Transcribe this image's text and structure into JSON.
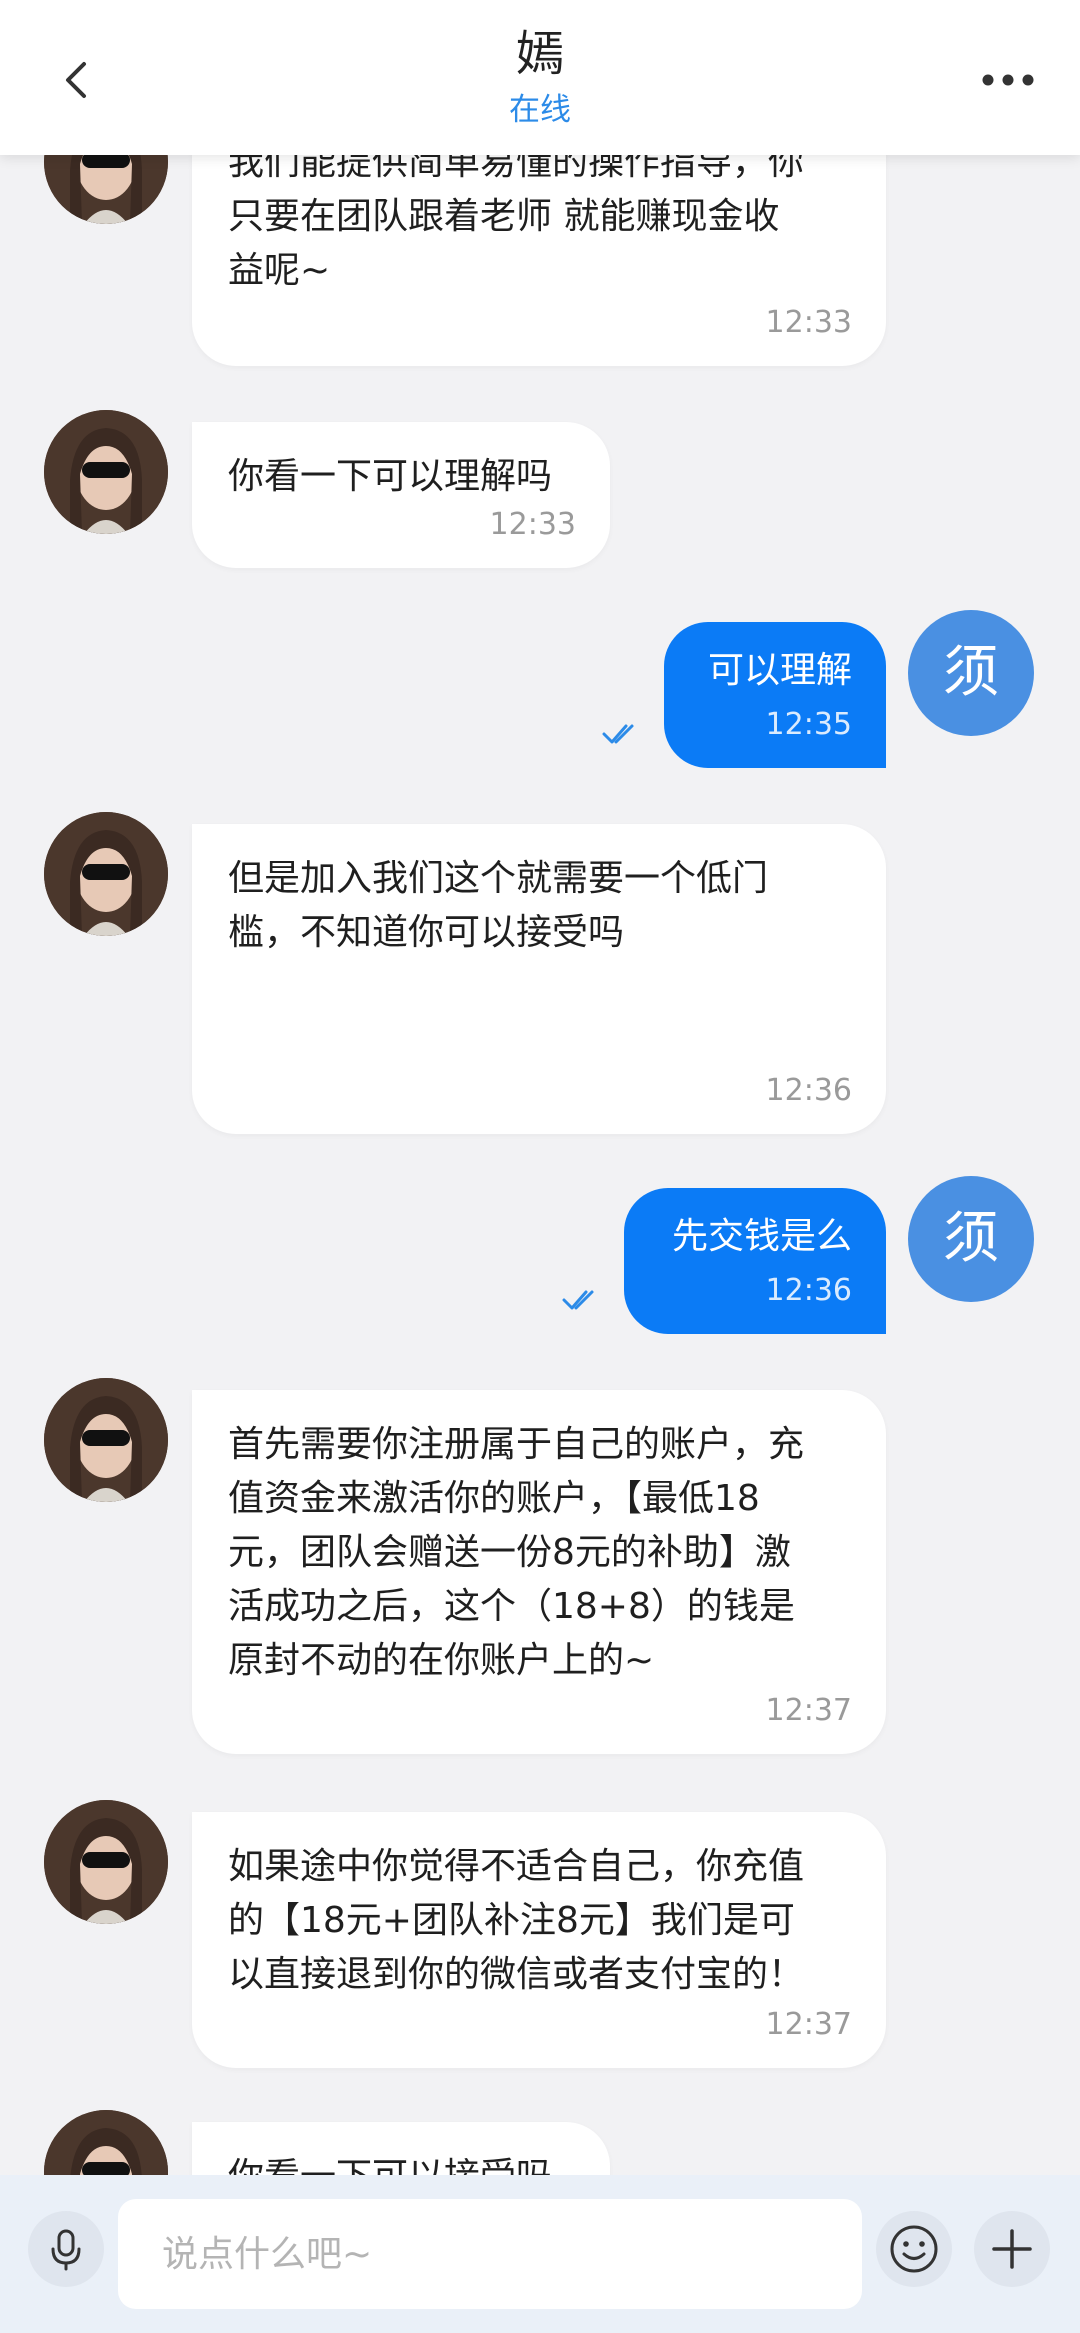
{
  "header": {
    "title": "嫣",
    "status": "在线",
    "back_icon": "chevron-left-icon",
    "more_icon": "more-horizontal-icon",
    "status_color": "#2c8be8"
  },
  "me": {
    "avatar_text": "须",
    "avatar_color": "#4a90e2",
    "bubble_color": "#0b7bf6"
  },
  "messages": [
    {
      "from": "her",
      "text": "我们能提供简单易懂的操作指导，你\n只要在团队跟着老师 就能赚现金收\n益呢~",
      "time": "12:33"
    },
    {
      "from": "her",
      "text": "你看一下可以理解吗",
      "time": "12:33"
    },
    {
      "from": "me",
      "text": "可以理解",
      "time": "12:35",
      "status": "read"
    },
    {
      "from": "her",
      "text": "但是加入我们这个就需要一个低门\n槛，不知道你可以接受吗",
      "time": "12:36"
    },
    {
      "from": "me",
      "text": "先交钱是么",
      "time": "12:36",
      "status": "read"
    },
    {
      "from": "her",
      "text": "首先需要你注册属于自己的账户，充\n值资金来激活你的账户，【最低18\n元，团队会赠送一份8元的补助】激\n活成功之后，这个（18+8）的钱是\n原封不动的在你账户上的~",
      "time": "12:37"
    },
    {
      "from": "her",
      "text": "如果途中你觉得不适合自己，你充值\n的【18元+团队补注8元】我们是可\n以直接退到你的微信或者支付宝的！",
      "time": "12:37"
    },
    {
      "from": "her",
      "text": "你看一下可以接受吗",
      "time": ""
    }
  ],
  "input": {
    "placeholder": "说点什么吧~",
    "value": "",
    "mic_icon": "microphone-icon",
    "emoji_icon": "emoji-smile-icon",
    "plus_icon": "plus-icon"
  }
}
